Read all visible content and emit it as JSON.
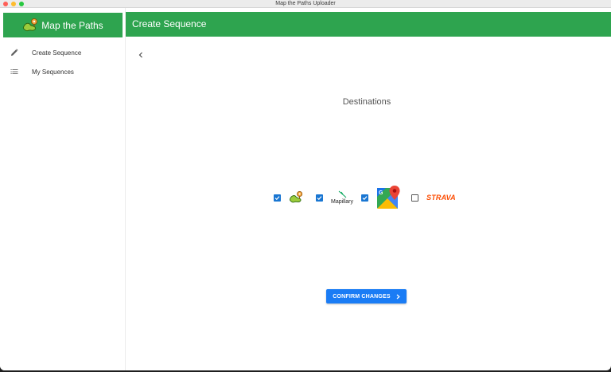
{
  "window": {
    "title": "Map the Paths Uploader"
  },
  "sidebar": {
    "brand": "Map the Paths",
    "items": [
      {
        "label": "Create Sequence",
        "icon": "pencil-icon"
      },
      {
        "label": "My Sequences",
        "icon": "list-icon"
      }
    ]
  },
  "header": {
    "title": "Create Sequence"
  },
  "main": {
    "section_title": "Destinations",
    "destinations": [
      {
        "name": "Map the Paths",
        "checked": true,
        "icon": "map-the-paths-icon"
      },
      {
        "name": "Mapillary",
        "label": "Mapillary",
        "checked": true,
        "icon": "mapillary-icon"
      },
      {
        "name": "Google Maps",
        "checked": true,
        "icon": "google-maps-icon"
      },
      {
        "name": "Strava",
        "label": "STRAVA",
        "checked": false,
        "icon": "strava-icon"
      }
    ],
    "confirm_label": "CONFIRM CHANGES"
  },
  "colors": {
    "brand_green": "#2ea44f",
    "primary_blue": "#1a7cf5",
    "checkbox_blue": "#1976d2",
    "strava_orange": "#fc4c02"
  }
}
